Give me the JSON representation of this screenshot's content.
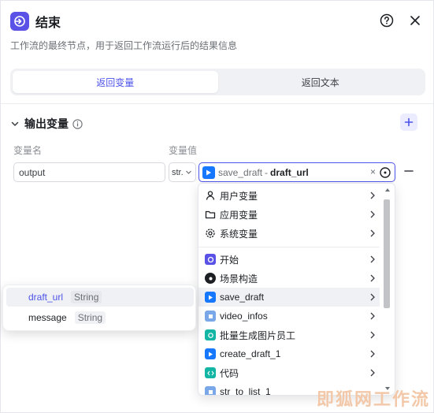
{
  "header": {
    "title": "结束",
    "description": "工作流的最终节点，用于返回工作流运行后的结果信息"
  },
  "tabs": [
    {
      "label": "返回变量",
      "active": true
    },
    {
      "label": "返回文本",
      "active": false
    }
  ],
  "output_section": {
    "title": "输出变量",
    "col_name": "变量名",
    "col_value": "变量值"
  },
  "row": {
    "name": "output",
    "type": "str.",
    "ref_node": "save_draft",
    "ref_sep": "-",
    "ref_var": "draft_url",
    "clear": "×"
  },
  "dropdown": {
    "items": [
      {
        "label": "用户变量",
        "icon": "user-icon"
      },
      {
        "label": "应用变量",
        "icon": "folder-icon"
      },
      {
        "label": "系统变量",
        "icon": "gear-icon"
      },
      {
        "label": "开始",
        "icon": "start-node-icon"
      },
      {
        "label": "场景构造",
        "icon": "scene-node-icon"
      },
      {
        "label": "save_draft",
        "icon": "capcut-node-icon"
      },
      {
        "label": "video_infos",
        "icon": "plugin-node-icon"
      },
      {
        "label": "批量生成图片员工",
        "icon": "loop-node-icon"
      },
      {
        "label": "create_draft_1",
        "icon": "capcut-node-icon"
      },
      {
        "label": "代码",
        "icon": "code-node-icon"
      },
      {
        "label": "str_to_list_1",
        "icon": "plugin-node-icon"
      }
    ]
  },
  "submenu": {
    "items": [
      {
        "name": "draft_url",
        "type": "String"
      },
      {
        "name": "message",
        "type": "String"
      }
    ]
  },
  "watermark": "即狐网工作流",
  "colors": {
    "accent": "#4d53e8",
    "node_icon": "#5a52e6"
  }
}
